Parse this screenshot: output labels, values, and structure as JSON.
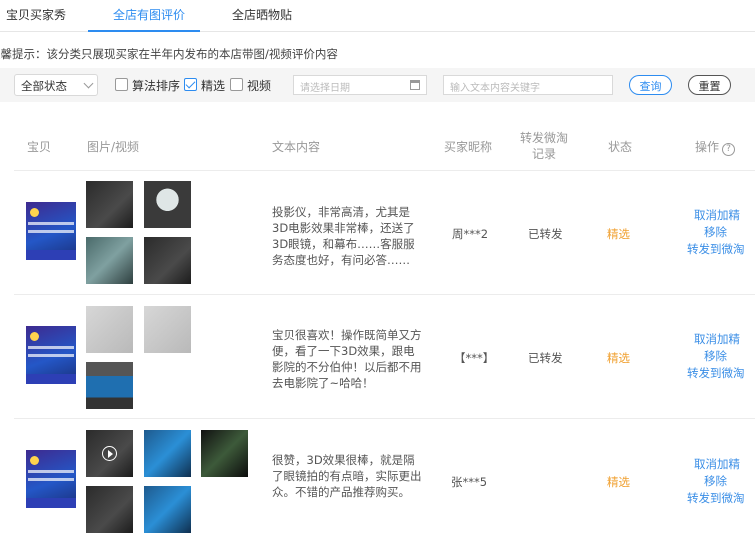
{
  "tabs": [
    "宝贝买家秀",
    "全店有图评价",
    "全店晒物贴"
  ],
  "tip": "温馨提示：该分类只展现买家在半年内发布的本店带图/视频评价内容",
  "filters": {
    "status_select": "全部状态",
    "algo_sort": {
      "label": "算法排序",
      "checked": false
    },
    "featured": {
      "label": "精选",
      "checked": true
    },
    "video": {
      "label": "视频",
      "checked": false
    },
    "date_placeholder": "请选择日期",
    "keyword_placeholder": "输入文本内容关键字",
    "query_button": "查询",
    "reset_button": "重置"
  },
  "columns": {
    "product": "宝贝",
    "media": "图片/视频",
    "text": "文本内容",
    "buyer": "买家昵称",
    "forward_l1": "转发微淘",
    "forward_l2": "记录",
    "status": "状态",
    "actions": "操作"
  },
  "rows": [
    {
      "text": "投影仪，非常高清，尤其是3D电影效果非常棒，还送了3D眼镜，和幕布……客服服务态度也好，有问必答……",
      "buyer": "周***2",
      "forward": "已转发",
      "status": "精选",
      "actions": [
        "取消加精",
        "移除",
        "转发到微淘"
      ]
    },
    {
      "text": "宝贝很喜欢！操作既简单又方便，看了一下3D效果，跟电影院的不分伯仲！以后都不用去电影院了~哈哈！",
      "buyer": "【***】",
      "forward": "已转发",
      "status": "精选",
      "actions": [
        "取消加精",
        "移除",
        "转发到微淘"
      ]
    },
    {
      "text": "很赞，3D效果很棒，就是隔了眼镜拍的有点暗，实际更出众。不错的产品推荐购买。",
      "buyer": "张***5",
      "forward": "",
      "status": "精选",
      "actions": [
        "取消加精",
        "移除",
        "转发到微淘"
      ]
    }
  ]
}
